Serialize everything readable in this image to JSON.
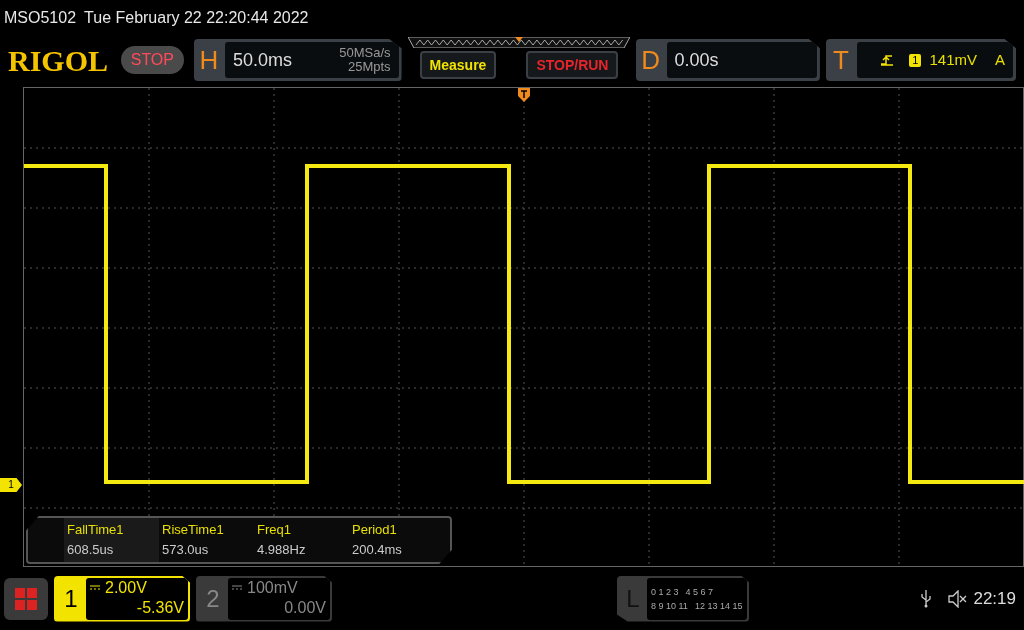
{
  "header": {
    "model": "MSO5102",
    "datetime": "Tue February 22 22:20:44 2022"
  },
  "toolbar": {
    "logo": "RIGOL",
    "run_state": {
      "label": "STOP",
      "kind": "stop"
    },
    "horizontal": {
      "letter": "H",
      "timebase": "50.0ms",
      "sample_rate": "50MSa/s",
      "memory_depth": "25Mpts"
    },
    "buttons": [
      {
        "label": "Measure",
        "kind": "measure"
      },
      {
        "label": "STOP/RUN",
        "kind": "run_control"
      }
    ],
    "delay": {
      "letter": "D",
      "value": "0.00s"
    },
    "trigger": {
      "letter": "T",
      "source": "1",
      "level": "141mV",
      "mode": "A"
    }
  },
  "waveform": {
    "channel_marker": "1"
  },
  "measurements": [
    {
      "name": "FallTime1",
      "value": "608.5us"
    },
    {
      "name": "RiseTime1",
      "value": "573.0us"
    },
    {
      "name": "Freq1",
      "value": "4.988Hz"
    },
    {
      "name": "Period1",
      "value": "200.4ms"
    }
  ],
  "channels": [
    {
      "number": "1",
      "scale": "2.00V",
      "offset": "-5.36V",
      "active": true
    },
    {
      "number": "2",
      "scale": "100mV",
      "offset": "0.00V",
      "active": false
    }
  ],
  "logic": {
    "letter": "L",
    "rows": [
      [
        "0 1 2 3",
        "4 5 6 7"
      ],
      [
        "8 9 10 11",
        "12 13 14 15"
      ]
    ]
  },
  "status": {
    "time": "22:19",
    "sound_muted": true
  }
}
